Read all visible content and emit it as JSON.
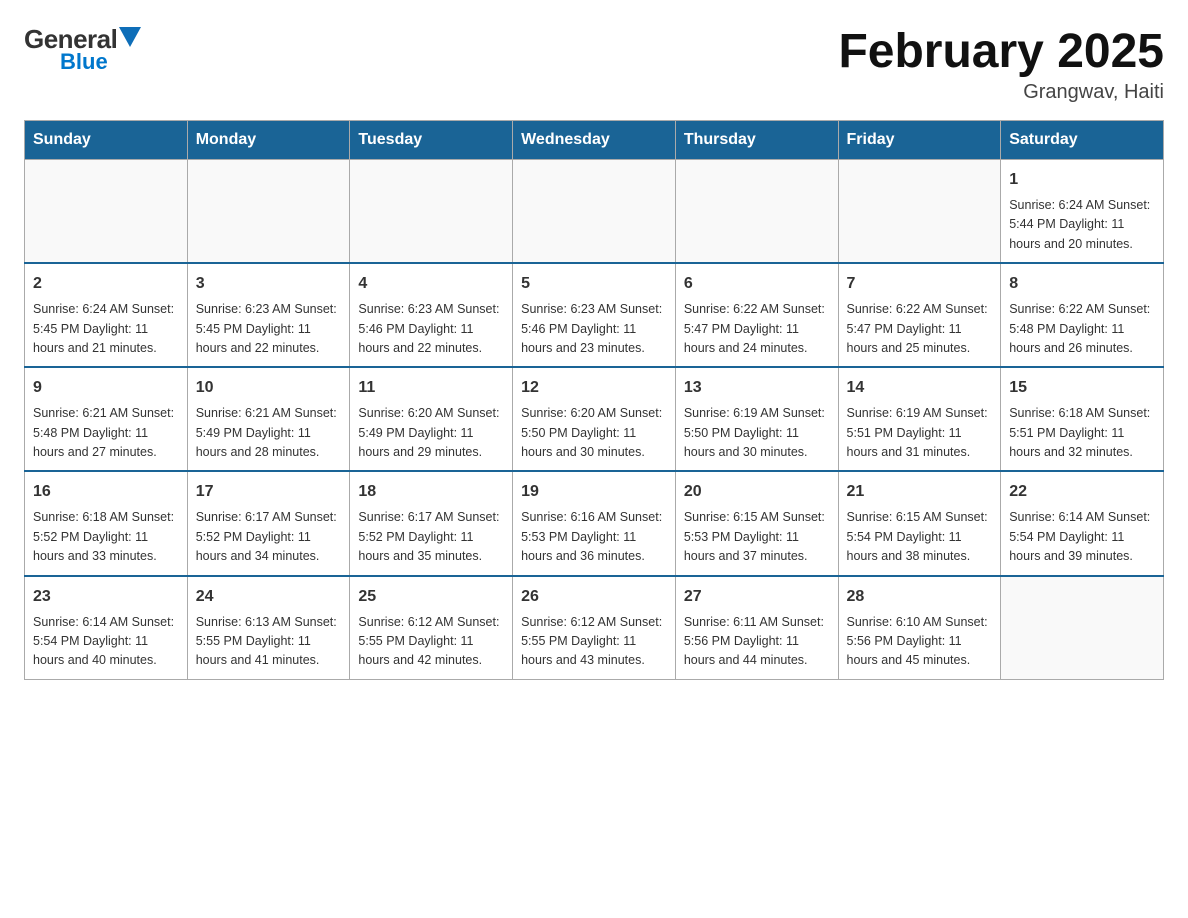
{
  "logo": {
    "general": "General",
    "blue": "Blue",
    "tagline": "GeneralBlue"
  },
  "header": {
    "title": "February 2025",
    "subtitle": "Grangwav, Haiti"
  },
  "weekdays": [
    "Sunday",
    "Monday",
    "Tuesday",
    "Wednesday",
    "Thursday",
    "Friday",
    "Saturday"
  ],
  "weeks": [
    [
      {
        "day": "",
        "info": ""
      },
      {
        "day": "",
        "info": ""
      },
      {
        "day": "",
        "info": ""
      },
      {
        "day": "",
        "info": ""
      },
      {
        "day": "",
        "info": ""
      },
      {
        "day": "",
        "info": ""
      },
      {
        "day": "1",
        "info": "Sunrise: 6:24 AM\nSunset: 5:44 PM\nDaylight: 11 hours\nand 20 minutes."
      }
    ],
    [
      {
        "day": "2",
        "info": "Sunrise: 6:24 AM\nSunset: 5:45 PM\nDaylight: 11 hours\nand 21 minutes."
      },
      {
        "day": "3",
        "info": "Sunrise: 6:23 AM\nSunset: 5:45 PM\nDaylight: 11 hours\nand 22 minutes."
      },
      {
        "day": "4",
        "info": "Sunrise: 6:23 AM\nSunset: 5:46 PM\nDaylight: 11 hours\nand 22 minutes."
      },
      {
        "day": "5",
        "info": "Sunrise: 6:23 AM\nSunset: 5:46 PM\nDaylight: 11 hours\nand 23 minutes."
      },
      {
        "day": "6",
        "info": "Sunrise: 6:22 AM\nSunset: 5:47 PM\nDaylight: 11 hours\nand 24 minutes."
      },
      {
        "day": "7",
        "info": "Sunrise: 6:22 AM\nSunset: 5:47 PM\nDaylight: 11 hours\nand 25 minutes."
      },
      {
        "day": "8",
        "info": "Sunrise: 6:22 AM\nSunset: 5:48 PM\nDaylight: 11 hours\nand 26 minutes."
      }
    ],
    [
      {
        "day": "9",
        "info": "Sunrise: 6:21 AM\nSunset: 5:48 PM\nDaylight: 11 hours\nand 27 minutes."
      },
      {
        "day": "10",
        "info": "Sunrise: 6:21 AM\nSunset: 5:49 PM\nDaylight: 11 hours\nand 28 minutes."
      },
      {
        "day": "11",
        "info": "Sunrise: 6:20 AM\nSunset: 5:49 PM\nDaylight: 11 hours\nand 29 minutes."
      },
      {
        "day": "12",
        "info": "Sunrise: 6:20 AM\nSunset: 5:50 PM\nDaylight: 11 hours\nand 30 minutes."
      },
      {
        "day": "13",
        "info": "Sunrise: 6:19 AM\nSunset: 5:50 PM\nDaylight: 11 hours\nand 30 minutes."
      },
      {
        "day": "14",
        "info": "Sunrise: 6:19 AM\nSunset: 5:51 PM\nDaylight: 11 hours\nand 31 minutes."
      },
      {
        "day": "15",
        "info": "Sunrise: 6:18 AM\nSunset: 5:51 PM\nDaylight: 11 hours\nand 32 minutes."
      }
    ],
    [
      {
        "day": "16",
        "info": "Sunrise: 6:18 AM\nSunset: 5:52 PM\nDaylight: 11 hours\nand 33 minutes."
      },
      {
        "day": "17",
        "info": "Sunrise: 6:17 AM\nSunset: 5:52 PM\nDaylight: 11 hours\nand 34 minutes."
      },
      {
        "day": "18",
        "info": "Sunrise: 6:17 AM\nSunset: 5:52 PM\nDaylight: 11 hours\nand 35 minutes."
      },
      {
        "day": "19",
        "info": "Sunrise: 6:16 AM\nSunset: 5:53 PM\nDaylight: 11 hours\nand 36 minutes."
      },
      {
        "day": "20",
        "info": "Sunrise: 6:15 AM\nSunset: 5:53 PM\nDaylight: 11 hours\nand 37 minutes."
      },
      {
        "day": "21",
        "info": "Sunrise: 6:15 AM\nSunset: 5:54 PM\nDaylight: 11 hours\nand 38 minutes."
      },
      {
        "day": "22",
        "info": "Sunrise: 6:14 AM\nSunset: 5:54 PM\nDaylight: 11 hours\nand 39 minutes."
      }
    ],
    [
      {
        "day": "23",
        "info": "Sunrise: 6:14 AM\nSunset: 5:54 PM\nDaylight: 11 hours\nand 40 minutes."
      },
      {
        "day": "24",
        "info": "Sunrise: 6:13 AM\nSunset: 5:55 PM\nDaylight: 11 hours\nand 41 minutes."
      },
      {
        "day": "25",
        "info": "Sunrise: 6:12 AM\nSunset: 5:55 PM\nDaylight: 11 hours\nand 42 minutes."
      },
      {
        "day": "26",
        "info": "Sunrise: 6:12 AM\nSunset: 5:55 PM\nDaylight: 11 hours\nand 43 minutes."
      },
      {
        "day": "27",
        "info": "Sunrise: 6:11 AM\nSunset: 5:56 PM\nDaylight: 11 hours\nand 44 minutes."
      },
      {
        "day": "28",
        "info": "Sunrise: 6:10 AM\nSunset: 5:56 PM\nDaylight: 11 hours\nand 45 minutes."
      },
      {
        "day": "",
        "info": ""
      }
    ]
  ]
}
